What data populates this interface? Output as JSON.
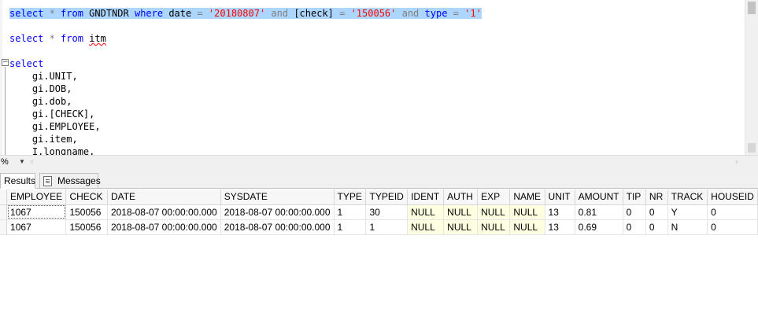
{
  "editor": {
    "line1": {
      "kw_select": "select",
      "star": " * ",
      "kw_from": "from",
      "table": " GNDTNDR ",
      "kw_where": "where",
      "col_date": " date ",
      "op_eq1": "=",
      "val_date": " '20180807' ",
      "op_and1": "and",
      "col_check": " [check] ",
      "op_eq2": "=",
      "val_check": " '150056' ",
      "op_and2": "and",
      "col_type": " type ",
      "op_eq3": "=",
      "val_type": " '1'"
    },
    "line2": {
      "kw_select": "select",
      "star": " * ",
      "kw_from": "from",
      "table": "itm"
    },
    "line3": {
      "kw_select": "select"
    },
    "column_lines": [
      "    gi.UNIT,",
      "    gi.DOB,",
      "    gi.dob,",
      "    gi.[CHECK],",
      "    gi.EMPLOYEE,",
      "    gi.item,",
      "    I.longname,"
    ],
    "collapse_glyph": "−"
  },
  "zoom": {
    "value": "%"
  },
  "tabs": {
    "results": "Results",
    "messages": "Messages"
  },
  "grid": {
    "columns": [
      "EMPLOYEE",
      "CHECK",
      "DATE",
      "SYSDATE",
      "TYPE",
      "TYPEID",
      "IDENT",
      "AUTH",
      "EXP",
      "NAME",
      "UNIT",
      "AMOUNT",
      "TIP",
      "NR",
      "TRACK",
      "HOUSEID"
    ],
    "rows": [
      [
        "1067",
        "150056",
        "2018-08-07 00:00:00.000",
        "2018-08-07 00:00:00.000",
        "1",
        "30",
        "NULL",
        "NULL",
        "NULL",
        "NULL",
        "13",
        "0.81",
        "0",
        "0",
        "Y",
        "0"
      ],
      [
        "1067",
        "150056",
        "2018-08-07 00:00:00.000",
        "2018-08-07 00:00:00.000",
        "1",
        "1",
        "NULL",
        "NULL",
        "NULL",
        "NULL",
        "13",
        "0.69",
        "0",
        "0",
        "N",
        "0"
      ]
    ],
    "null_columns": [
      6,
      7,
      8,
      9
    ],
    "colors": {
      "null_bg": "#ffffe1",
      "header_bg": "#f7f7f7",
      "selection": "#add6ff"
    }
  }
}
